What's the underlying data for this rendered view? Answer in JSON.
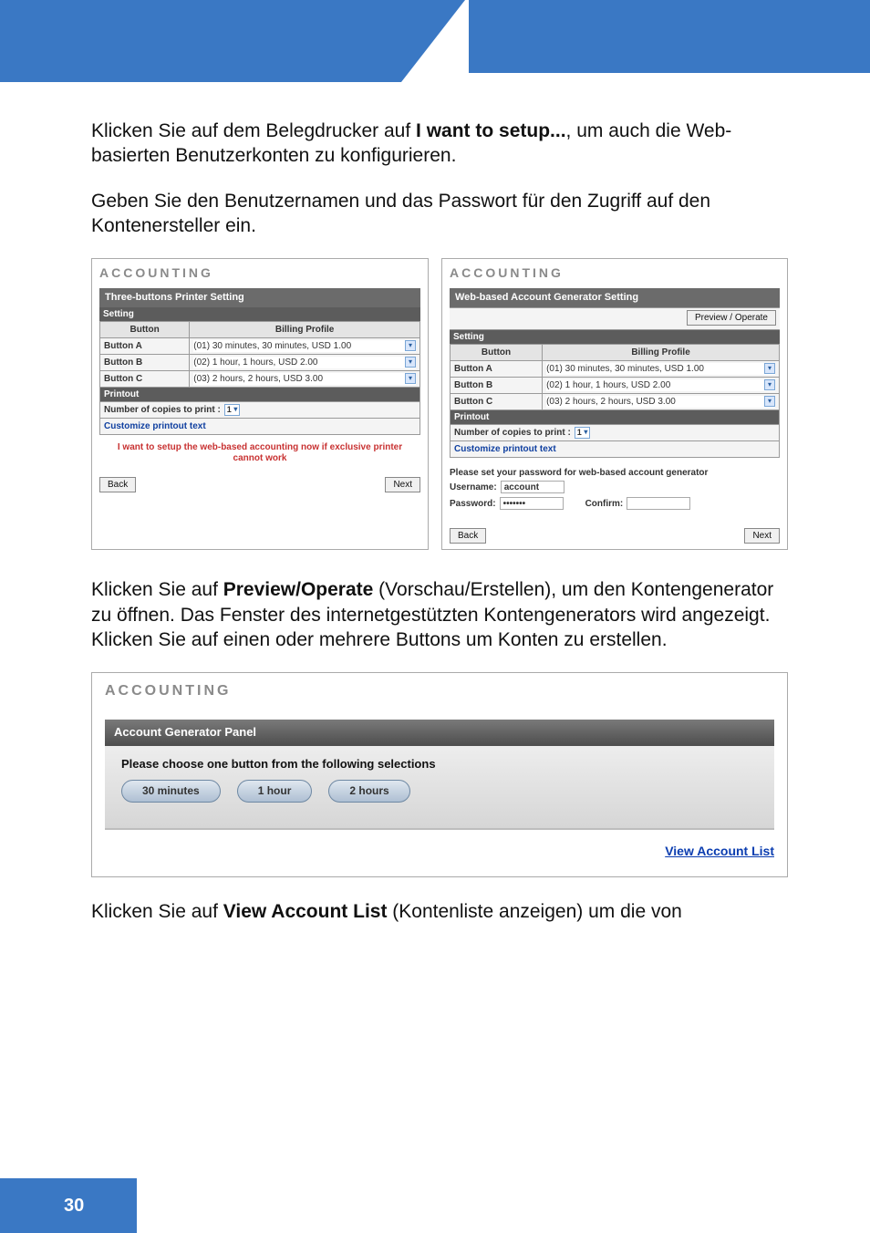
{
  "header_blue": true,
  "paragraphs": {
    "p1_a": "Klicken Sie auf dem Belegdrucker auf ",
    "p1_bold": "I want to setup...",
    "p1_b": ", um auch die Web-basierten Benutzerkonten zu konfigurieren.",
    "p2": "Geben Sie den Benutzernamen und das Passwort für den Zugriff auf den Kontenersteller ein.",
    "p3_a": "Klicken Sie auf ",
    "p3_bold": "Preview/Operate",
    "p3_b": " (Vorschau/Erstellen), um den Kontengenerator zu öffnen. Das Fenster des internetgestützten Kontengenerators wird angezeigt. Klicken Sie auf einen oder mehrere Buttons um Konten zu erstellen.",
    "p4_a": "Klicken Sie auf ",
    "p4_bold": "View Account List",
    "p4_b": " (Kontenliste anzeigen) um die von"
  },
  "shot1": {
    "title": "ACCOUNTING",
    "panel_title": "Three-buttons Printer Setting",
    "setting_label": "Setting",
    "col_button": "Button",
    "col_profile": "Billing Profile",
    "rows": [
      {
        "name": "Button A",
        "profile": "(01) 30 minutes, 30 minutes, USD 1.00"
      },
      {
        "name": "Button B",
        "profile": "(02) 1 hour, 1 hours, USD 2.00"
      },
      {
        "name": "Button C",
        "profile": "(03) 2 hours, 2 hours, USD 3.00"
      }
    ],
    "printout_label": "Printout",
    "copies_label": "Number of copies to print :",
    "copies_value": "1",
    "customize_link": "Customize printout text",
    "red_line1": "I want to setup the web-based accounting now if exclusive printer",
    "red_line2": "cannot work",
    "back": "Back",
    "next": "Next"
  },
  "shot2": {
    "title": "ACCOUNTING",
    "panel_title": "Web-based Account Generator Setting",
    "preview_btn": "Preview / Operate",
    "setting_label": "Setting",
    "col_button": "Button",
    "col_profile": "Billing Profile",
    "rows": [
      {
        "name": "Button A",
        "profile": "(01) 30 minutes, 30 minutes, USD 1.00"
      },
      {
        "name": "Button B",
        "profile": "(02) 1 hour, 1 hours, USD 2.00"
      },
      {
        "name": "Button C",
        "profile": "(03) 2 hours, 2 hours, USD 3.00"
      }
    ],
    "printout_label": "Printout",
    "copies_label": "Number of copies to print :",
    "copies_value": "1",
    "customize_link": "Customize printout text",
    "pw_instr": "Please set your password for web-based account generator",
    "username_label": "Username:",
    "username_value": "account",
    "password_label": "Password:",
    "password_value": "•••••••",
    "confirm_label": "Confirm:",
    "back": "Back",
    "next": "Next"
  },
  "shot3": {
    "title": "ACCOUNTING",
    "panel_title": "Account Generator Panel",
    "instruction": "Please choose one button from the following selections",
    "buttons": [
      "30 minutes",
      "1 hour",
      "2 hours"
    ],
    "view_link": "View Account List"
  },
  "page_number": "30"
}
